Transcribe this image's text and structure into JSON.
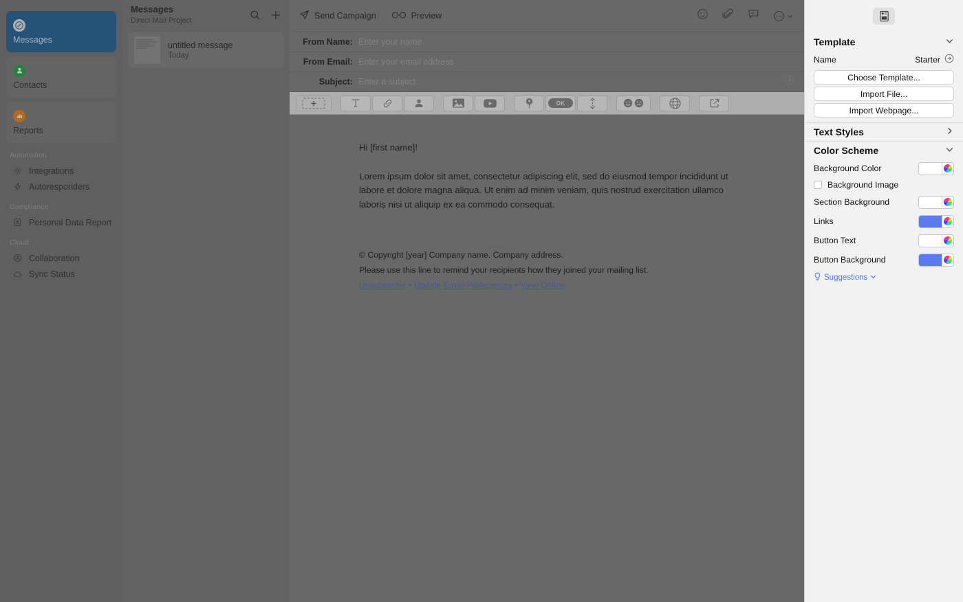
{
  "sidebar": {
    "primary": [
      {
        "label": "Messages",
        "icon": "compose-pencil-icon",
        "selected": true
      },
      {
        "label": "Contacts",
        "icon": "person-icon",
        "selected": false
      },
      {
        "label": "Reports",
        "icon": "bar-chart-icon",
        "selected": false
      }
    ],
    "groups": [
      {
        "title": "Automation",
        "items": [
          {
            "label": "Integrations",
            "icon": "gear-icon"
          },
          {
            "label": "Autoresponders",
            "icon": "bolt-icon"
          }
        ]
      },
      {
        "title": "Compliance",
        "items": [
          {
            "label": "Personal Data Report",
            "icon": "document-person-icon"
          }
        ]
      },
      {
        "title": "Cloud",
        "items": [
          {
            "label": "Collaboration",
            "icon": "collaboration-icon"
          },
          {
            "label": "Sync Status",
            "icon": "cloud-icon"
          }
        ]
      }
    ]
  },
  "message_list": {
    "title": "Messages",
    "subtitle": "Direct Mail Project",
    "actions": [
      "search-icon",
      "add-icon"
    ],
    "items": [
      {
        "name": "untitled message",
        "date": "Today"
      }
    ]
  },
  "editor": {
    "toolbar": {
      "send_label": "Send Campaign",
      "preview_label": "Preview",
      "right_icons": [
        "emoji-icon",
        "attachment-icon",
        "comment-icon",
        "more-icon"
      ]
    },
    "fields": [
      {
        "label": "From Name:",
        "placeholder": "Enter your name",
        "value": ""
      },
      {
        "label": "From Email:",
        "placeholder": "Enter your email address",
        "value": ""
      },
      {
        "label": "Subject:",
        "placeholder": "Enter a subject",
        "value": ""
      }
    ],
    "block_toolbar": [
      {
        "name": "add-block-icon",
        "title": "Add Block"
      },
      {
        "name": "text-icon",
        "title": "Text"
      },
      {
        "name": "link-icon",
        "title": "Link"
      },
      {
        "name": "contact-icon",
        "title": "Contact"
      },
      {
        "name": "image-icon",
        "title": "Image"
      },
      {
        "name": "video-icon",
        "title": "Video"
      },
      {
        "name": "pin-icon",
        "title": "Pin"
      },
      {
        "name": "button-icon",
        "title": "Button",
        "label": "OK"
      },
      {
        "name": "spacer-icon",
        "title": "Spacer"
      },
      {
        "name": "survey-icon",
        "title": "Survey"
      },
      {
        "name": "social-globe-icon",
        "title": "Social"
      },
      {
        "name": "share-icon",
        "title": "Share"
      }
    ],
    "body": {
      "greeting": "Hi [first name]!",
      "paragraph": "Lorem ipsum dolor sit amet, consectetur adipiscing elit, sed do eiusmod tempor incididunt ut labore et dolore magna aliqua. Ut enim ad minim veniam, quis nostrud exercitation ullamco laboris nisi ut aliquip ex ea commodo consequat."
    },
    "footer": {
      "copyright": "© Copyright [year] Company name. Company address.",
      "reminder": "Please use this line to remind your recipients how they joined your mailing list.",
      "links": [
        "Unsubscribe",
        "Update Email Preferences",
        "View Online"
      ],
      "separator": "•"
    }
  },
  "inspector": {
    "tab_icon": "template-layout-icon",
    "template": {
      "heading": "Template",
      "name_label": "Name",
      "name_value": "Starter",
      "buttons": [
        "Choose Template...",
        "Import File...",
        "Import Webpage..."
      ]
    },
    "text_styles": {
      "heading": "Text Styles"
    },
    "color_scheme": {
      "heading": "Color Scheme",
      "rows": [
        {
          "label": "Background Color",
          "color": "#ffffff"
        },
        {
          "label": "Section Background",
          "color": "#ffffff"
        },
        {
          "label": "Links",
          "color": "#5b7cf0"
        },
        {
          "label": "Button Text",
          "color": "#ffffff"
        },
        {
          "label": "Button Background",
          "color": "#5b7cf0"
        }
      ],
      "background_image_label": "Background Image",
      "background_image_checked": false,
      "suggestions_label": "Suggestions"
    }
  },
  "colors": {
    "selected_nav": "#1c5e93",
    "contacts_icon": "#1f9e3f",
    "reports_icon": "#e87b15",
    "link_blue": "#4b64c4",
    "accent_blue": "#5b7cf0"
  }
}
